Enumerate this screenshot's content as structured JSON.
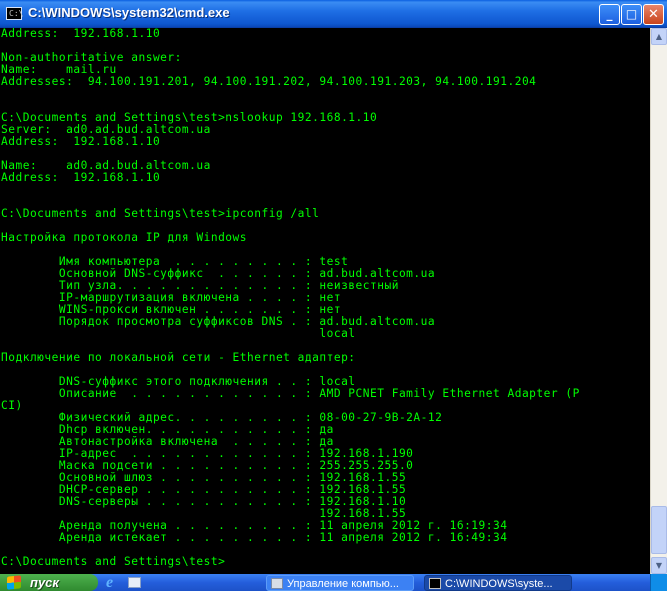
{
  "window": {
    "title": "C:\\WINDOWS\\system32\\cmd.exe",
    "icon_text": "C:\\",
    "buttons": {
      "minimize": "_",
      "maximize": "□",
      "close": "✕"
    }
  },
  "console": {
    "lines": [
      "Address:  192.168.1.10",
      "",
      "Non-authoritative answer:",
      "Name:    mail.ru",
      "Addresses:  94.100.191.201, 94.100.191.202, 94.100.191.203, 94.100.191.204",
      "",
      "",
      "C:\\Documents and Settings\\test>nslookup 192.168.1.10",
      "Server:  ad0.ad.bud.altcom.ua",
      "Address:  192.168.1.10",
      "",
      "Name:    ad0.ad.bud.altcom.ua",
      "Address:  192.168.1.10",
      "",
      "",
      "C:\\Documents and Settings\\test>ipconfig /all",
      "",
      "Настройка протокола IP для Windows",
      "",
      "        Имя компьютера  . . . . . . . . . : test",
      "        Основной DNS-суффикс  . . . . . . : ad.bud.altcom.ua",
      "        Тип узла. . . . . . . . . . . . . : неизвестный",
      "        IP-маршрутизация включена . . . . : нет",
      "        WINS-прокси включен . . . . . . . : нет",
      "        Порядок просмотра суффиксов DNS . : ad.bud.altcom.ua",
      "                                            local",
      "",
      "Подключение по локальной сети - Ethernet адаптер:",
      "",
      "        DNS-суффикс этого подключения . . : local",
      "        Описание  . . . . . . . . . . . . : AMD PCNET Family Ethernet Adapter (P",
      "CI)",
      "        Физический адрес. . . . . . . . . : 08-00-27-9B-2A-12",
      "        Dhcp включен. . . . . . . . . . . : да",
      "        Автонастройка включена  . . . . . : да",
      "        IP-адрес  . . . . . . . . . . . . : 192.168.1.190",
      "        Маска подсети . . . . . . . . . . : 255.255.255.0",
      "        Основной шлюз . . . . . . . . . . : 192.168.1.55",
      "        DHCP-сервер . . . . . . . . . . . : 192.168.1.55",
      "        DNS-серверы . . . . . . . . . . . : 192.168.1.10",
      "                                            192.168.1.55",
      "        Аренда получена . . . . . . . . . : 11 апреля 2012 г. 16:19:34",
      "        Аренда истекает . . . . . . . . . : 11 апреля 2012 г. 16:49:34",
      "",
      "C:\\Documents and Settings\\test>"
    ],
    "text_color": "#00ff00",
    "background": "#000000"
  },
  "scrollbar": {
    "up_arrow": "▲",
    "down_arrow": "▼"
  },
  "taskbar": {
    "start_label": "пуск",
    "quick_launch": [
      "internet-explorer-icon",
      "show-desktop-icon"
    ],
    "ie_glyph": "e",
    "items": [
      {
        "label": "Управление компью...",
        "active": false
      },
      {
        "label": "C:\\WINDOWS\\syste...",
        "active": true
      }
    ]
  }
}
